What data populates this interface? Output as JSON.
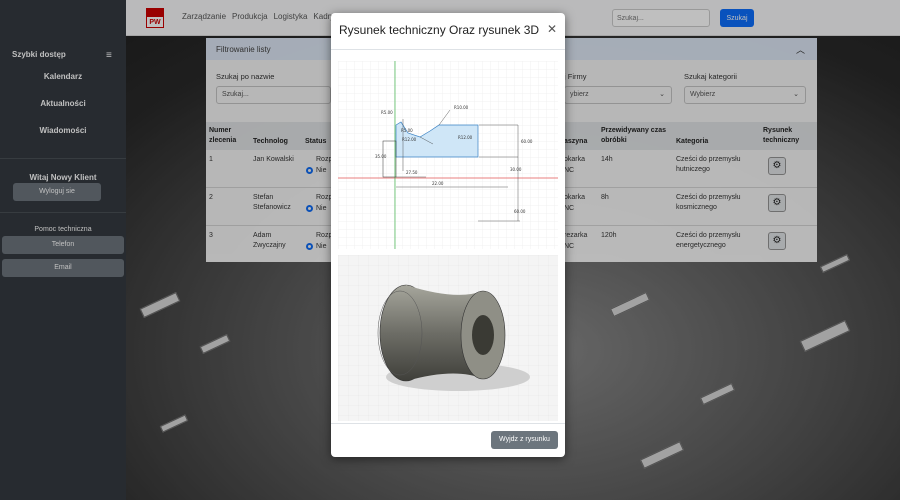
{
  "nav": {
    "logo_text": "PW",
    "links": [
      "Zarządzanie",
      "Produkcja",
      "Logistyka",
      "Kadry"
    ],
    "search_placeholder": "Szukaj...",
    "search_button": "Szukaj"
  },
  "sidebar": {
    "title": "Szybki dostęp",
    "items": [
      "Kalendarz",
      "Aktualności",
      "Wiadomości"
    ],
    "welcome": "Witaj Nowy Klient",
    "logout": "Wyloguj sie",
    "help_title": "Pomoc techniczna",
    "contacts": [
      "Telefon",
      "Email"
    ]
  },
  "filters": {
    "panel_title": "Filtrowanie listy",
    "name_label": "Szukaj po nazwie",
    "name_placeholder": "Szukaj...",
    "firm_label": "j Firmy",
    "firm_value": "ybierz",
    "category_label": "Szukaj kategorii",
    "category_value": "Wybierz"
  },
  "table": {
    "headers": {
      "number": "Numer zlecenia",
      "technolog": "Technolog",
      "status": "Status",
      "machine": "aszyna",
      "time": "Przewidywany czas obróbki",
      "category": "Kategoria",
      "drawing": "Rysunek techniczny"
    },
    "rows": [
      {
        "num": "1",
        "tech": "Jan Kowalski",
        "status1": "Rozp",
        "status2": "Nie",
        "machine1": "okarka",
        "machine2": "NC",
        "time": "14h",
        "category": "Cześci do przemysłu hutniczego"
      },
      {
        "num": "2",
        "tech": "Stefan Stefanowicz",
        "status1": "Rozp",
        "status2": "Nie",
        "machine1": "okarka",
        "machine2": "NC",
        "time": "8h",
        "category": "Cześci do przemysłu kosmicznego"
      },
      {
        "num": "3",
        "tech": "Adam Zwyczajny",
        "status1": "Rozp",
        "status2": "Nie",
        "machine1": "rezarka",
        "machine2": "NC",
        "time": "120h",
        "category": "Cześci do przemysłu energetycznego"
      }
    ]
  },
  "modal": {
    "title": "Rysunek techniczny Oraz rysunek 3D",
    "close_icon": "close-icon",
    "exit_button": "Wyjdz z rysunku",
    "dims": [
      "R5.00",
      "R5.00",
      "R12.00",
      "R12.00",
      "R10.00",
      "60.00",
      "35.00",
      "30.00",
      "27.50",
      "22.00",
      "60.00"
    ]
  }
}
